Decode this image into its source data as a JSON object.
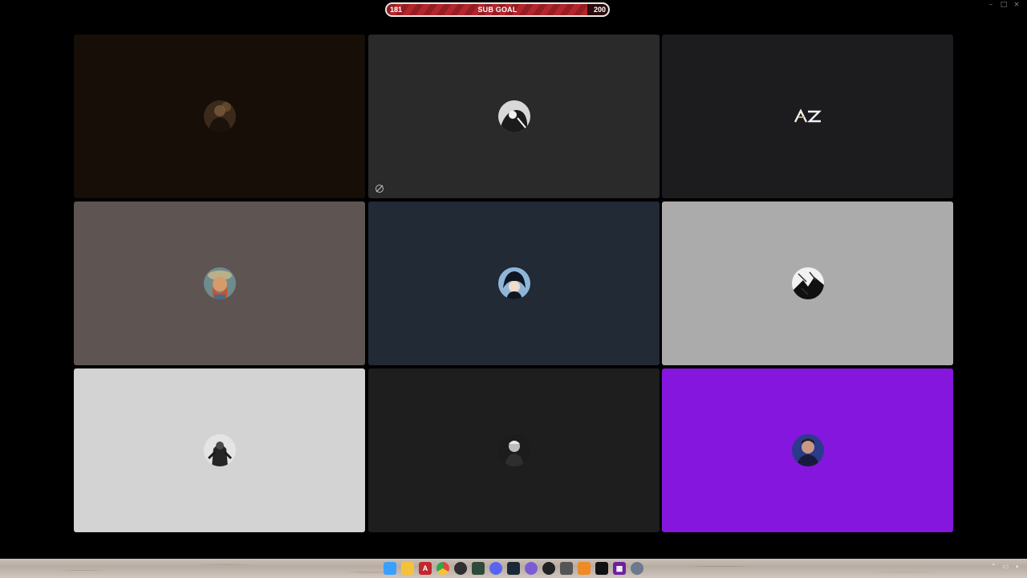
{
  "subgoal": {
    "current": "181",
    "label": "SUB GOAL",
    "goal": "200",
    "progress": 0.905,
    "fill_color": "#b3262c"
  },
  "window_controls": {
    "minimize": "–",
    "maximize": "□",
    "close": "×"
  },
  "tiles": [
    {
      "id": "user-1",
      "bg": "#160e07",
      "avatar": "man-dark-portrait"
    },
    {
      "id": "user-2",
      "bg": "#2a2a2a",
      "avatar": "bw-figure",
      "muted": true
    },
    {
      "id": "user-3",
      "bg": "#1c1c1f",
      "avatar": "az-logo",
      "logo_text": "AZ"
    },
    {
      "id": "user-4",
      "bg": "#5e5452",
      "avatar": "van-gogh-portrait"
    },
    {
      "id": "user-5",
      "bg": "#212a35",
      "avatar": "anime-character"
    },
    {
      "id": "user-6",
      "bg": "#ababab",
      "avatar": "manga-sketch"
    },
    {
      "id": "user-7",
      "bg": "#d3d3d3",
      "avatar": "armored-figure"
    },
    {
      "id": "user-8",
      "bg": "#1e1e1e",
      "avatar": "man-bw-portrait"
    },
    {
      "id": "user-9",
      "bg": "#8516dd",
      "avatar": "man-blue-portrait"
    }
  ],
  "taskbar": {
    "icons": [
      {
        "name": "windows-start-icon",
        "color": "#3aa0ff"
      },
      {
        "name": "file-explorer-icon",
        "color": "#f4c23a"
      },
      {
        "name": "acrobat-icon",
        "color": "#c1272d",
        "glyph": "A"
      },
      {
        "name": "chrome-icon",
        "color": "#e2453b"
      },
      {
        "name": "obs-icon",
        "color": "#302e31"
      },
      {
        "name": "terminal-icon",
        "color": "#2e4a3a"
      },
      {
        "name": "discord-icon",
        "color": "#5865f2"
      },
      {
        "name": "steam-icon",
        "color": "#1b2838"
      },
      {
        "name": "chat-app-icon",
        "color": "#7b5cd6"
      },
      {
        "name": "circle-g-icon",
        "color": "#222222"
      },
      {
        "name": "mouse-app-icon",
        "color": "#555555"
      },
      {
        "name": "flame-app-icon",
        "color": "#f08a24"
      },
      {
        "name": "vr-goggles-icon",
        "color": "#111111"
      },
      {
        "name": "stream-deck-icon",
        "color": "#6e1f9e",
        "glyph": "▦"
      },
      {
        "name": "settings-gear-icon",
        "color": "#6b7a8c"
      }
    ]
  }
}
